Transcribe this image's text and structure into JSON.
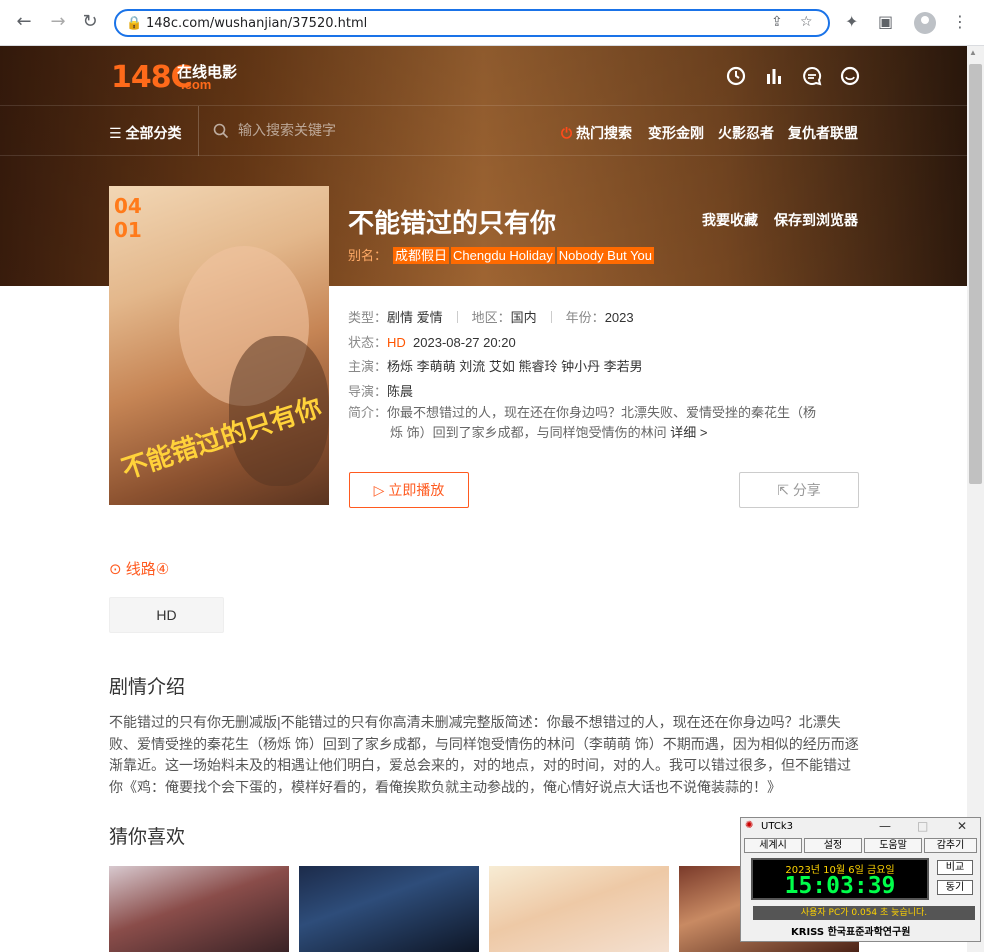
{
  "browser": {
    "url": "148c.com/wushanjian/37520.html"
  },
  "site": {
    "logo_num": "148C",
    "logo_cn": "在线电影",
    "logo_com": ".com",
    "all_categories": "全部分类",
    "search_placeholder": "输入搜索关键字",
    "hot_search": "热门搜索",
    "hot_links": [
      "变形金刚",
      "火影忍者",
      "复仇者联盟"
    ],
    "header_icons": [
      "clock-icon",
      "chart-icon",
      "message-icon",
      "smile-icon"
    ]
  },
  "movie": {
    "title": "不能错过的只有你",
    "favorite": "我要收藏",
    "save_browser": "保存到浏览器",
    "alias_label": "别名：",
    "aliases": [
      "成都假日",
      "Chengdu Holiday",
      "Nobody But You"
    ],
    "type_label": "类型：",
    "type_value": "剧情 爱情",
    "region_label": "地区：",
    "region_value": "国内",
    "year_label": "年份：",
    "year_value": "2023",
    "status_label": "状态：",
    "status_value": "HD",
    "status_time": "2023-08-27 20:20",
    "cast_label": "主演：",
    "cast_value": "杨烁 李萌萌 刘流 艾如 熊睿玲 钟小丹 李若男",
    "director_label": "导演：",
    "director_value": "陈晨",
    "intro_label": "简介：",
    "intro_line1": "你最不想错过的人，现在还在你身边吗？北漂失败、爱情受挫的秦花生（杨",
    "intro_line2": "烁 饰）回到了家乡成都，与同样饱受情伤的林问",
    "intro_more": "详细 >",
    "play_button": "立即播放",
    "share_button": "分享",
    "poster_date_month": "04",
    "poster_date_day": "01",
    "poster_title": "不能错过的只有你"
  },
  "route": {
    "label": "线路④",
    "episode": "HD"
  },
  "plot": {
    "heading": "剧情介绍",
    "text": "不能错过的只有你无删减版|不能错过的只有你高清未删减完整版简述：你最不想错过的人，现在还在你身边吗？北漂失败、爱情受挫的秦花生（杨烁 饰）回到了家乡成都，与同样饱受情伤的林问（李萌萌 饰）不期而遇，因为相似的经历而逐渐靠近。这一场始料未及的相遇让他们明白，爱总会来的，对的地点，对的时间，对的人。我可以错过很多，但不能错过你《鸡：俺要找个会下蛋的，模样好看的，看俺挨欺负就主动参战的，俺心情好说点大话也不说俺装蒜的！》"
  },
  "recommend": {
    "heading": "猜你喜欢"
  },
  "utc_widget": {
    "title": "UTCk3",
    "buttons": [
      "세계시",
      "설정",
      "도움말",
      "감추기"
    ],
    "date": "2023년  10월  6일  금요일",
    "time": "15:03:39",
    "side_buttons": [
      "비교",
      "동기"
    ],
    "status": "사용자 PC가 0.054 초 늦습니다.",
    "brand": "KRISS 한국표준과학연구원"
  },
  "colors": {
    "accent": "#ff5a1f",
    "alias_tag": "#ff6a00",
    "hero_dark": "#3b1d0d",
    "hero_mid": "#a76a35"
  }
}
